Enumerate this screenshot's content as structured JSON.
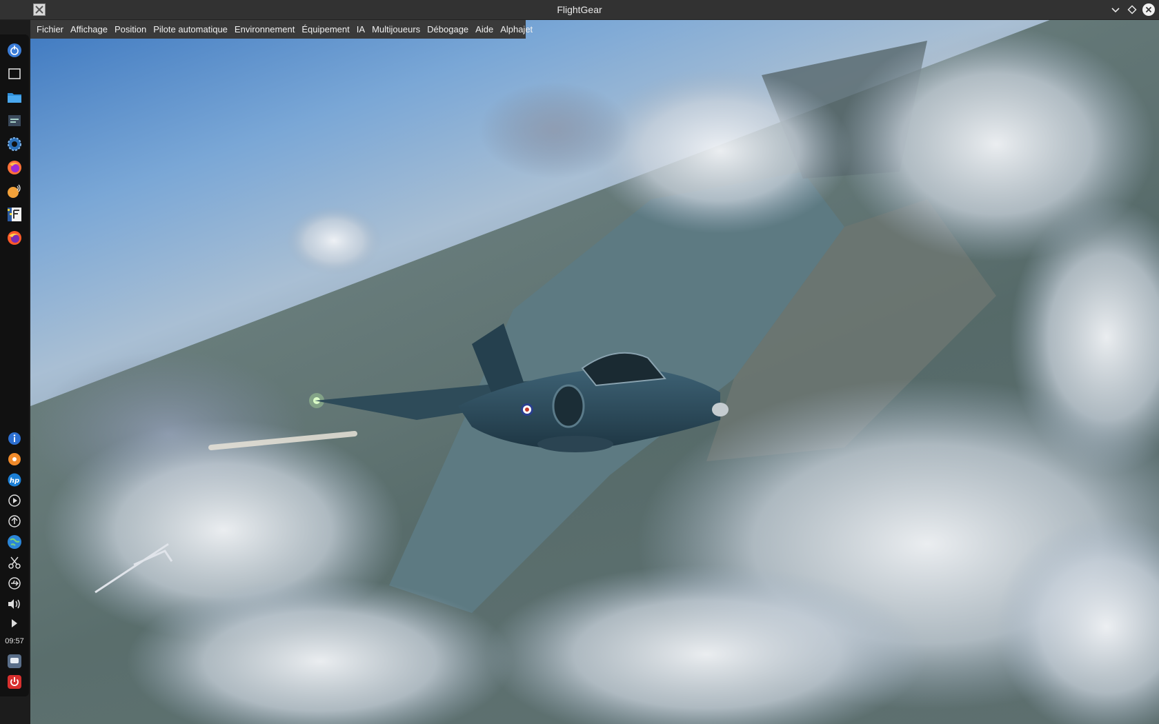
{
  "window": {
    "title": "FlightGear"
  },
  "menu": {
    "items": [
      "Fichier",
      "Affichage",
      "Position",
      "Pilote automatique",
      "Environnement",
      "Équipement",
      "IA",
      "Multijoueurs",
      "Débogage",
      "Aide",
      "Alphajet"
    ]
  },
  "dock": {
    "time": "09:57",
    "top_icons": [
      "power-menu-icon",
      "desktop-icon",
      "file-manager-icon",
      "settings-icon",
      "system-gear-icon",
      "firefox-icon",
      "audio-player-icon",
      "flightgear-icon",
      "firefox-alt-icon"
    ],
    "bottom_icons": [
      "info-icon",
      "media-icon",
      "hp-icon",
      "play-icon",
      "update-icon",
      "network-globe-icon",
      "scissors-icon",
      "usb-icon",
      "volume-icon",
      "expand-arrow-icon"
    ],
    "footer_icons": [
      "drive-icon",
      "shutdown-icon"
    ]
  },
  "colors": {
    "titlebar": "#323232",
    "menubar": "#3a3a3a",
    "sky": "#7aa7d6",
    "lake": "#5d7a82",
    "aircraft": "#2c4a5a"
  }
}
